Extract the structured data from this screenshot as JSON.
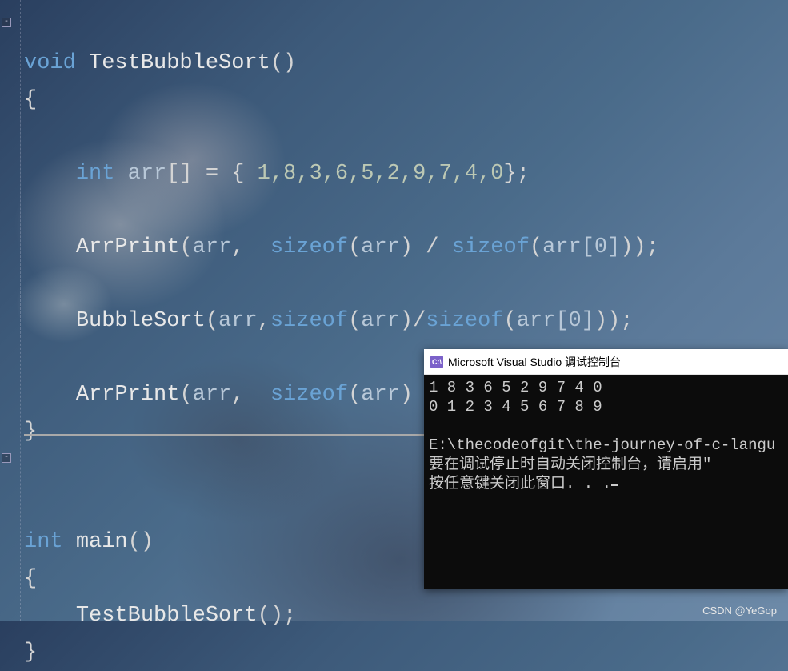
{
  "code": {
    "fn1_sig_kw": "void",
    "fn1_name": "TestBubbleSort",
    "fn1_parens": "()",
    "brace_open": "{",
    "brace_close": "}",
    "decl_kw": "int",
    "decl_name": "arr",
    "decl_brackets": "[]",
    "decl_eq": " = ",
    "decl_lbrace": "{ ",
    "arr_values": "1,8,3,6,5,2,9,7,4,0",
    "decl_rbrace": "};",
    "call1_fn": "ArrPrint",
    "call_arr": "arr",
    "sizeof_kw": "sizeof",
    "arr0": "arr[0]",
    "comma_sp": ", ",
    "comma": ",",
    "slash_sp": " / ",
    "slash": "/",
    "semi": ";",
    "call2_fn": "BubbleSort",
    "fn2_kw": "int",
    "fn2_name": "main",
    "call3_fn": "TestBubbleSort",
    "rparen_semi": ");",
    "lparen": "(",
    "rparen": ")"
  },
  "console": {
    "title": "Microsoft Visual Studio 调试控制台",
    "icon_text": "C:\\",
    "out_line1": "1 8 3 6 5 2 9 7 4 0",
    "out_line2": "0 1 2 3 4 5 6 7 8 9",
    "out_line3": "",
    "out_line4": "E:\\thecodeofgit\\the-journey-of-c-langu",
    "out_line5": "要在调试停止时自动关闭控制台，请启用\"",
    "out_line6": "按任意键关闭此窗口. . ."
  },
  "fold_glyph": "-",
  "watermark": "CSDN @YeGop"
}
